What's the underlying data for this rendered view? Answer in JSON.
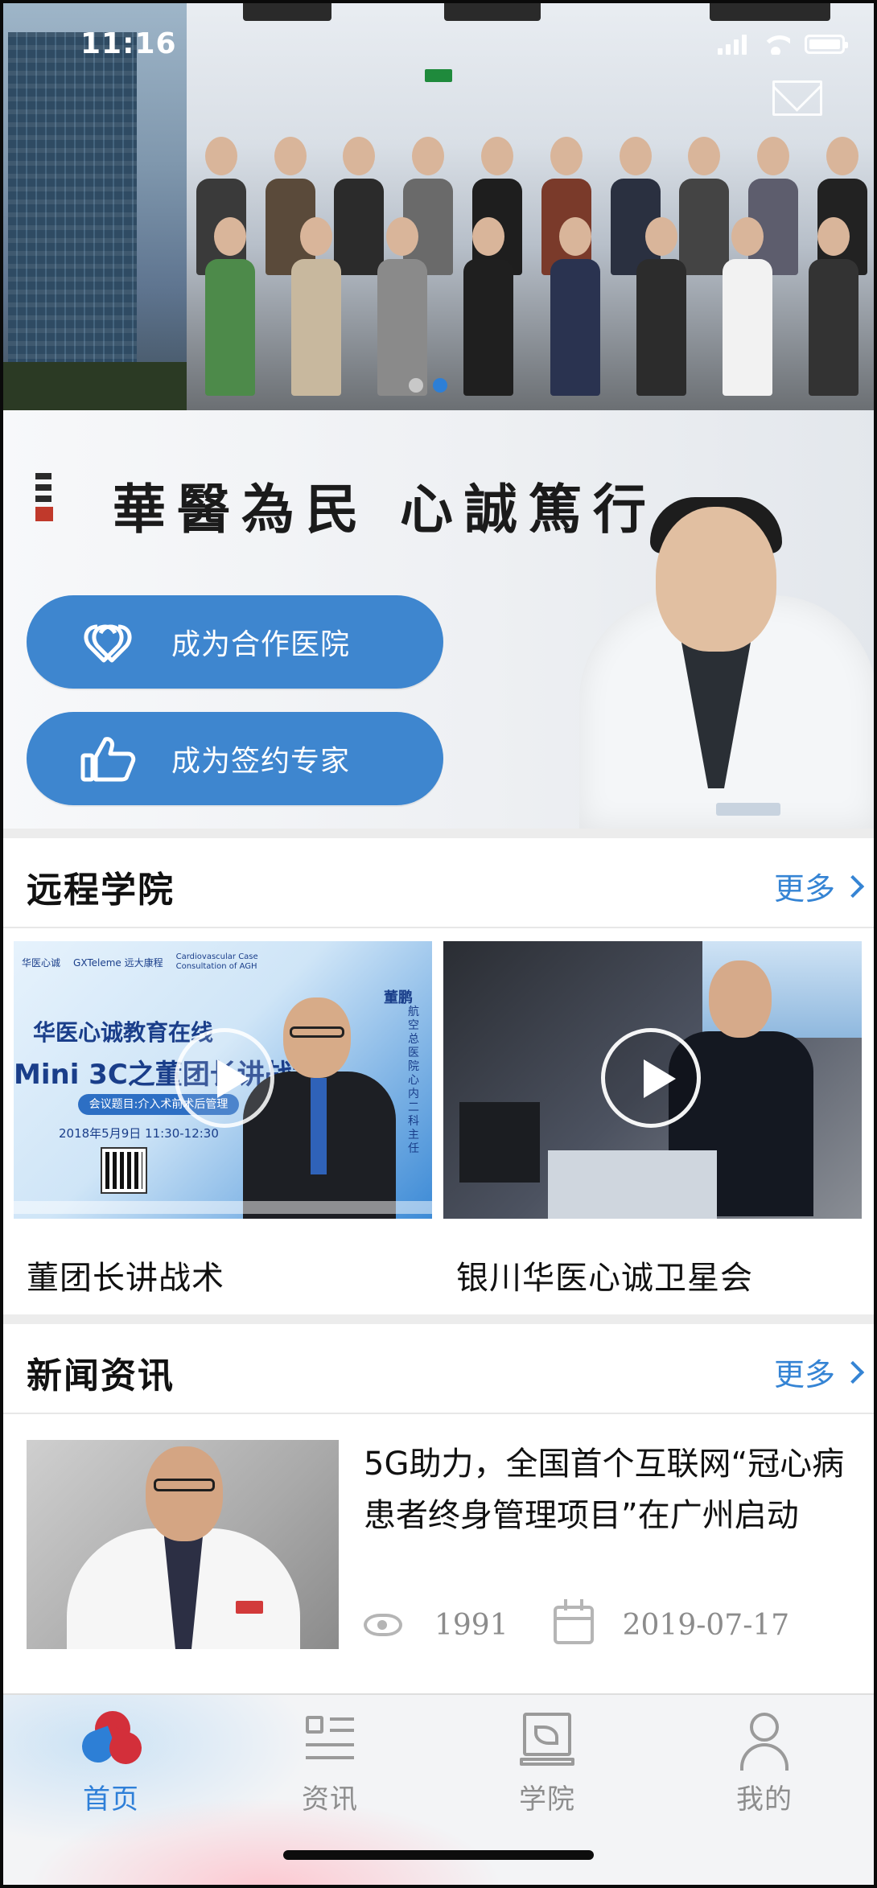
{
  "status_bar": {
    "time": "11:16"
  },
  "hero": {
    "carousel_active_index": 1,
    "carousel_count": 2
  },
  "promo": {
    "calligraphy": "華醫為民 心誠篤行",
    "buttons": [
      {
        "label": "成为合作医院",
        "icon": "heart-link-icon"
      },
      {
        "label": "成为签约专家",
        "icon": "thumbs-up-icon"
      }
    ]
  },
  "academy": {
    "title": "远程学院",
    "more_label": "更多",
    "videos": [
      {
        "caption": "董团长讲战术",
        "thumb": {
          "org1": "华医心诚",
          "org2": "GXTeleme 远大康程",
          "org3": "Cardiovascular Case Consultation of AGH",
          "title": "华医心诚教育在线",
          "subtitle": "Mini 3C之董团长讲战术",
          "topic": "会议题目:介入术前术后管理",
          "date": "2018年5月9日 11:30-12:30",
          "speaker": "董鹏",
          "speaker_title": "航空总医院心内二科主任"
        }
      },
      {
        "caption": "银川华医心诚卫星会"
      }
    ]
  },
  "news": {
    "title": "新闻资讯",
    "more_label": "更多",
    "items": [
      {
        "title": "5G助力，全国首个互联网“冠心病患者终身管理项目”在广州启动",
        "views": "1991",
        "date": "2019-07-17"
      }
    ]
  },
  "tab_bar": {
    "tabs": [
      {
        "label": "首页",
        "icon": "home-logo-icon",
        "active": true
      },
      {
        "label": "资讯",
        "icon": "news-icon",
        "active": false
      },
      {
        "label": "学院",
        "icon": "academy-icon",
        "active": false
      },
      {
        "label": "我的",
        "icon": "profile-icon",
        "active": false
      }
    ]
  },
  "colors": {
    "accent_blue": "#3e86cf",
    "link_blue": "#3584d4",
    "brand_red": "#d32f3a",
    "inactive_gray": "#8d8d8d"
  }
}
